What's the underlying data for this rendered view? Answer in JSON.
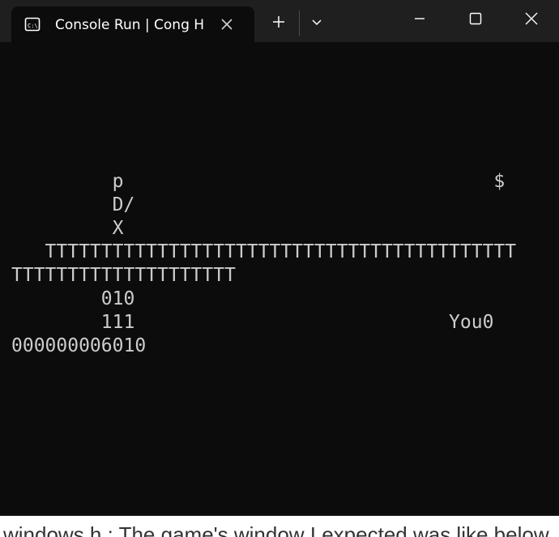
{
  "window": {
    "tab_title": "Console Run  |  Cong H",
    "icons": {
      "tab": "terminal-icon",
      "close_tab": "close-icon",
      "new_tab": "plus-icon",
      "dropdown": "chevron-down-icon",
      "minimize": "minimize-icon",
      "maximize": "maximize-icon",
      "close_window": "close-icon"
    }
  },
  "terminal": {
    "lines": [
      "         p                                 $",
      "         D/",
      "         X",
      "   TTTTTTTTTTTTTTTTTTTTTTTTTTTTTTTTTTTTTTTTTT",
      "TTTTTTTTTTTTTTTTTTTT",
      "        010",
      "        111                            You0",
      "000000006010"
    ]
  },
  "background_page": {
    "text": "windows.h : The game's window I expected was like below."
  },
  "colors": {
    "terminal_bg": "#0c0c0c",
    "titlebar_bg": "#1f1f1f",
    "text": "#cccccc"
  }
}
